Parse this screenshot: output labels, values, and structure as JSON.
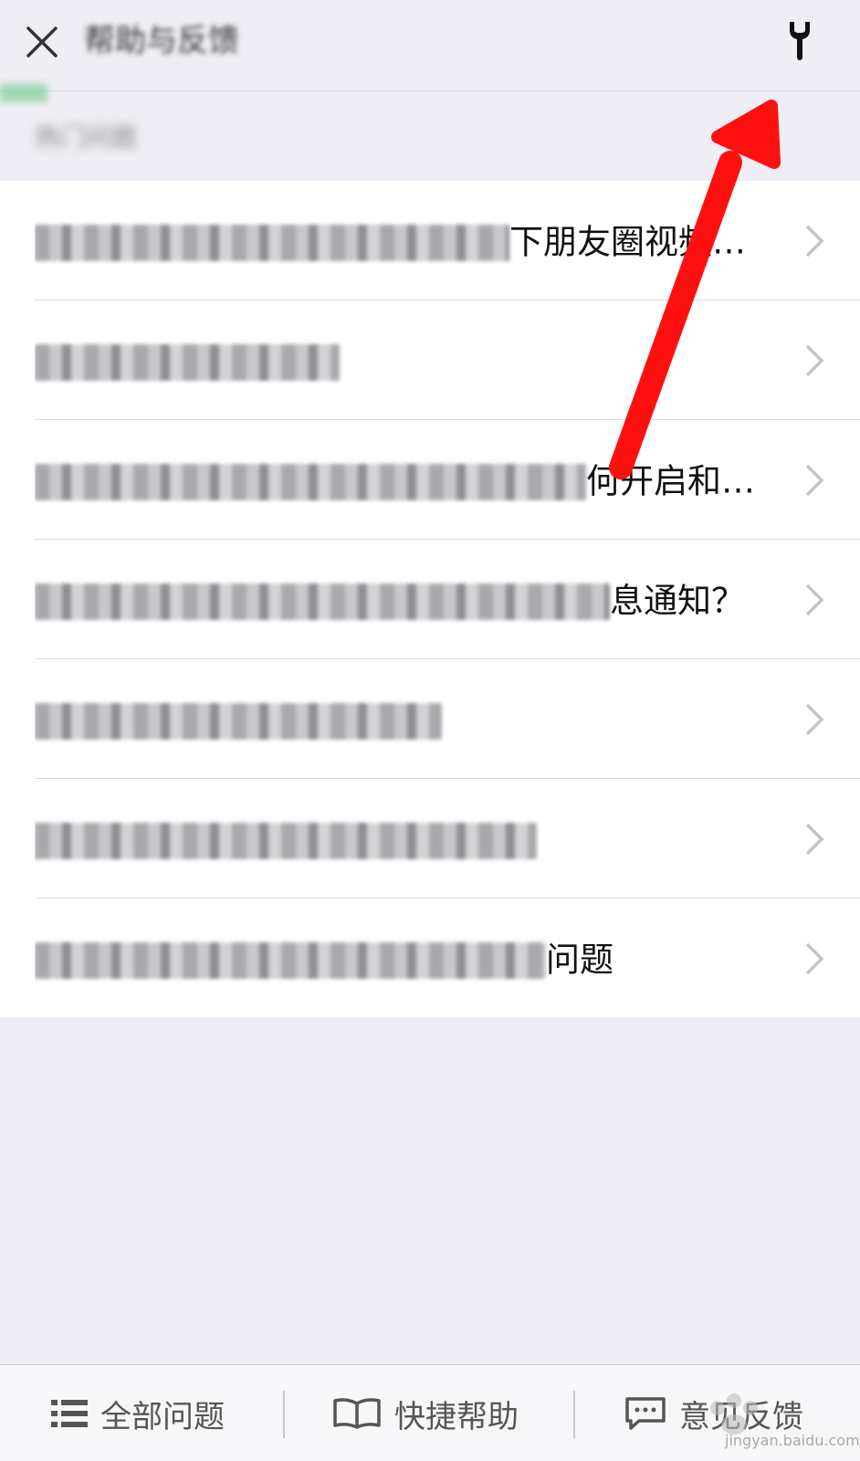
{
  "header": {
    "title": "帮助与反馈",
    "close_icon": "close-icon",
    "wrench_icon": "wrench-icon"
  },
  "section": {
    "label": "热门问题"
  },
  "list": {
    "items": [
      {
        "visible_text": "下朋友圈视频…"
      },
      {
        "visible_text": ""
      },
      {
        "visible_text": "何开启和…"
      },
      {
        "visible_text": "息通知？"
      },
      {
        "visible_text": ""
      },
      {
        "visible_text": ""
      },
      {
        "visible_text": "问题"
      }
    ]
  },
  "bottom_tabs": {
    "all_questions": "全部问题",
    "quick_help": "快捷帮助",
    "feedback": "意见反馈"
  },
  "watermark": {
    "brand": "Baidu 经验",
    "url": "jingyan.baidu.com"
  },
  "colors": {
    "background": "#efeef4",
    "list_bg": "#ffffff",
    "arrow": "#ff1010",
    "progress": "#9fd8b1"
  }
}
